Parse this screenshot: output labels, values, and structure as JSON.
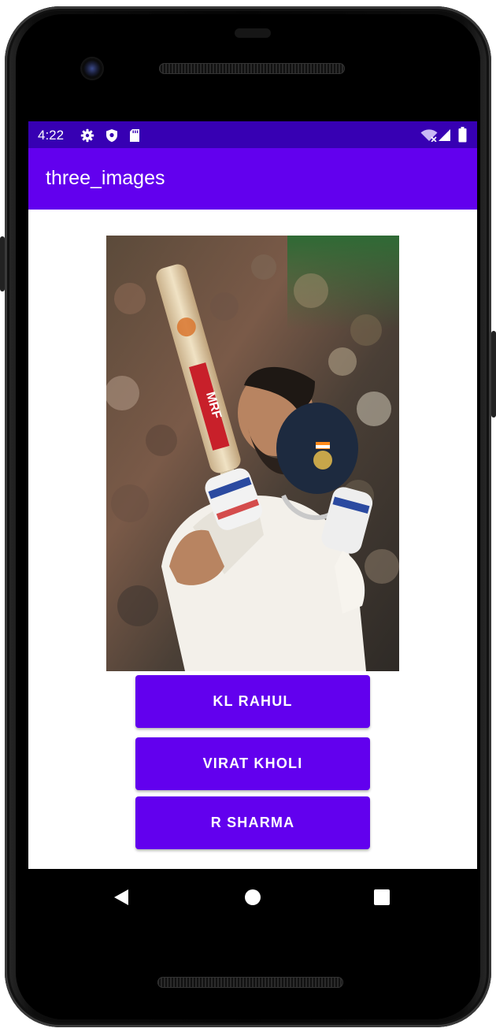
{
  "status_bar": {
    "time": "4:22",
    "left_icons": [
      "gear-icon",
      "shield-icon",
      "sd-card-icon"
    ],
    "right_icons": [
      "wifi-icon",
      "signal-icon",
      "battery-icon"
    ]
  },
  "app_bar": {
    "title": "three_images"
  },
  "image": {
    "subject": "cricket-player-photo"
  },
  "buttons": [
    {
      "label": "KL RAHUL"
    },
    {
      "label": "VIRAT KHOLI"
    },
    {
      "label": "R SHARMA"
    }
  ],
  "nav_bar": {
    "icons": [
      "back-icon",
      "home-icon",
      "recents-icon"
    ]
  },
  "colors": {
    "status_bar": "#3700b3",
    "app_bar": "#6200ee",
    "button": "#6200ee",
    "button_text": "#ffffff"
  }
}
